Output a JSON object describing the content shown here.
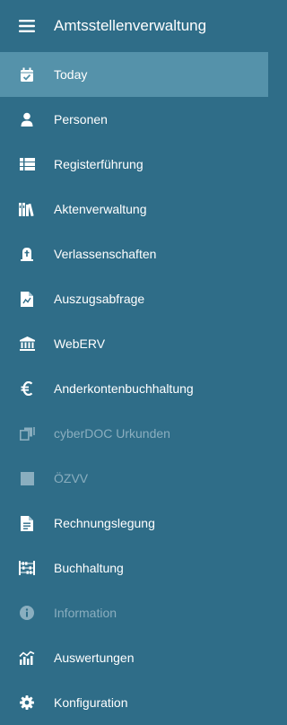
{
  "header": {
    "menu_icon": "hamburger-menu-icon",
    "title": "Amtsstellenverwaltung"
  },
  "colors": {
    "background": "#2f6d88",
    "active": "#5592aa",
    "text": "#ffffff",
    "disabled_text": "#8aaebf"
  },
  "nav": {
    "items": [
      {
        "label": "Today",
        "icon": "calendar-check-icon",
        "active": true,
        "disabled": false
      },
      {
        "label": "Personen",
        "icon": "person-icon",
        "active": false,
        "disabled": false
      },
      {
        "label": "Registerführung",
        "icon": "table-list-icon",
        "active": false,
        "disabled": false
      },
      {
        "label": "Aktenverwaltung",
        "icon": "books-icon",
        "active": false,
        "disabled": false
      },
      {
        "label": "Verlassenschaften",
        "icon": "gravestone-icon",
        "active": false,
        "disabled": false
      },
      {
        "label": "Auszugsabfrage",
        "icon": "document-chart-icon",
        "active": false,
        "disabled": false
      },
      {
        "label": "WebERV",
        "icon": "bank-building-icon",
        "active": false,
        "disabled": false
      },
      {
        "label": "Anderkontenbuchhaltung",
        "icon": "euro-icon",
        "active": false,
        "disabled": false
      },
      {
        "label": "cyberDOC Urkunden",
        "icon": "document-archive-icon",
        "active": false,
        "disabled": true
      },
      {
        "label": "ÖZVV",
        "icon": "square-icon",
        "active": false,
        "disabled": true
      },
      {
        "label": "Rechnungslegung",
        "icon": "invoice-document-icon",
        "active": false,
        "disabled": false
      },
      {
        "label": "Buchhaltung",
        "icon": "abacus-icon",
        "active": false,
        "disabled": false
      },
      {
        "label": "Information",
        "icon": "info-circle-icon",
        "active": false,
        "disabled": true
      },
      {
        "label": "Auswertungen",
        "icon": "analytics-chart-icon",
        "active": false,
        "disabled": false
      },
      {
        "label": "Konfiguration",
        "icon": "gear-icon",
        "active": false,
        "disabled": false
      }
    ]
  }
}
